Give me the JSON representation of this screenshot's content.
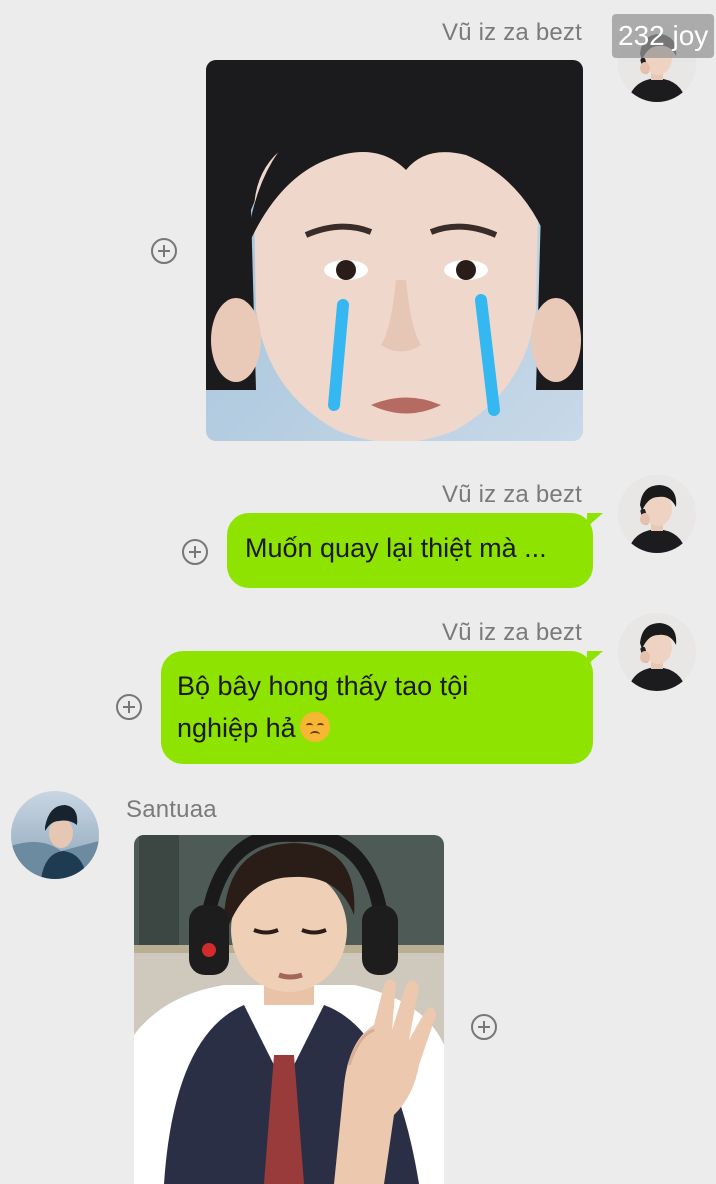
{
  "messages": [
    {
      "sender": "Vũ iz za bezt",
      "type": "image",
      "image_desc": "crying-face-sticker"
    },
    {
      "sender": "Vũ iz za bezt",
      "type": "text",
      "text": "Muốn quay lại thiệt mà ..."
    },
    {
      "sender": "Vũ iz za bezt",
      "type": "text",
      "text_line1": "Bộ bây hong thấy tao tội",
      "text_line2": "nghiệp hả",
      "emoji": "disappointed-face"
    },
    {
      "sender": "Santuaa",
      "type": "image",
      "image_desc": "headphones-meme"
    }
  ],
  "overlay_badge": "232 joy",
  "colors": {
    "background": "#ececec",
    "bubble": "#8fe300",
    "sender_name": "#7a7a7a"
  }
}
